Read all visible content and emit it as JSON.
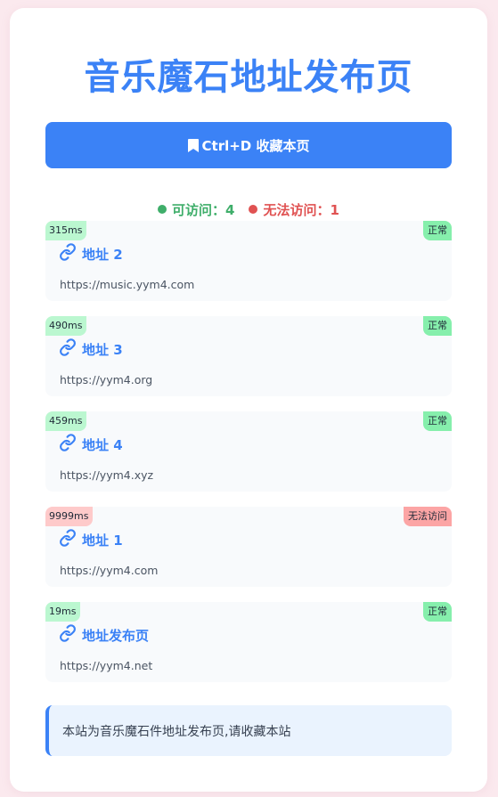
{
  "page": {
    "title": "音乐魔石地址发布页",
    "bookmark_label": "Ctrl+D 收藏本页",
    "colors": {
      "accent": "#3b82f6",
      "ok": "#3fae6a",
      "bad": "#e05252"
    }
  },
  "stats": {
    "accessible_label": "可访问：4",
    "inaccessible_label": "无法访问：1"
  },
  "items": [
    {
      "latency": "315ms",
      "status": "正常",
      "name": "地址 2",
      "url": "https://music.yym4.com",
      "ok": true
    },
    {
      "latency": "490ms",
      "status": "正常",
      "name": "地址 3",
      "url": "https://yym4.org",
      "ok": true
    },
    {
      "latency": "459ms",
      "status": "正常",
      "name": "地址 4",
      "url": "https://yym4.xyz",
      "ok": true
    },
    {
      "latency": "9999ms",
      "status": "无法访问",
      "name": "地址 1",
      "url": "https://yym4.com",
      "ok": false
    },
    {
      "latency": "19ms",
      "status": "正常",
      "name": "地址发布页",
      "url": "https://yym4.net",
      "ok": true
    }
  ],
  "notice": {
    "text": "本站为音乐魔石件地址发布页,请收藏本站"
  }
}
